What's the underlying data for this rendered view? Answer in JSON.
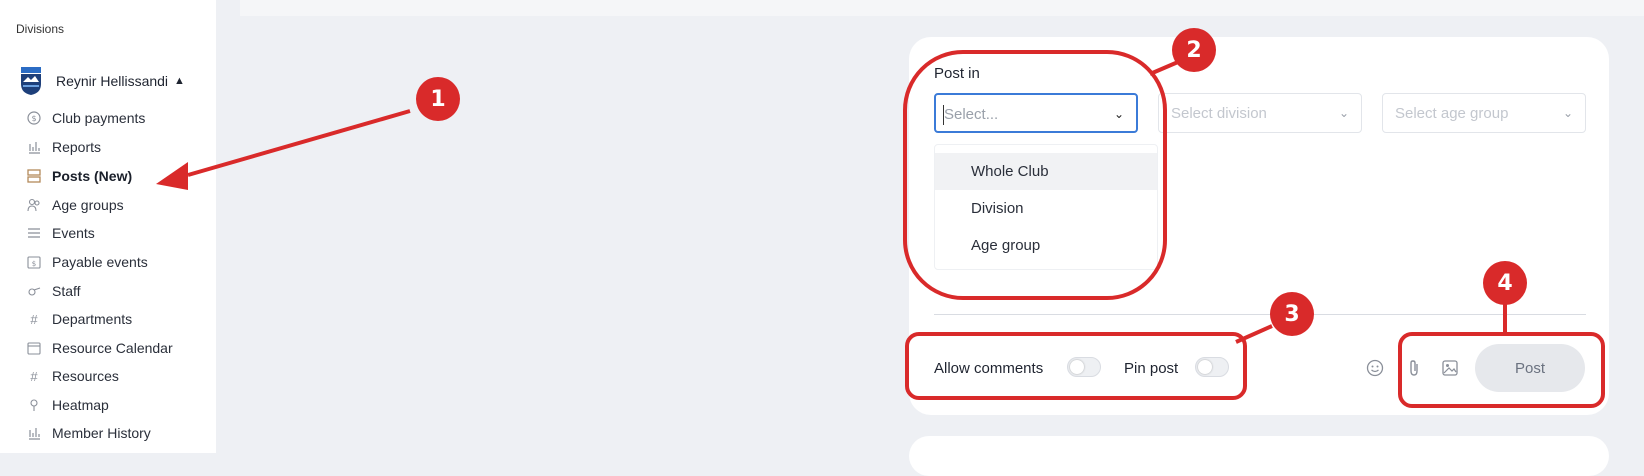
{
  "sidebar": {
    "title": "Divisions",
    "club_name": "Reynir Hellissandi",
    "items": [
      {
        "label": "Club payments",
        "icon": "dollar-circle-icon"
      },
      {
        "label": "Reports",
        "icon": "bar-chart-icon"
      },
      {
        "label": "Posts (New)",
        "icon": "posts-icon"
      },
      {
        "label": "Age groups",
        "icon": "users-icon"
      },
      {
        "label": "Events",
        "icon": "list-icon"
      },
      {
        "label": "Payable events",
        "icon": "calendar-dollar-icon"
      },
      {
        "label": "Staff",
        "icon": "whistle-icon"
      },
      {
        "label": "Departments",
        "icon": "hash-icon"
      },
      {
        "label": "Resource Calendar",
        "icon": "calendar-icon"
      },
      {
        "label": "Resources",
        "icon": "hash-icon"
      },
      {
        "label": "Heatmap",
        "icon": "pin-icon"
      },
      {
        "label": "Member History",
        "icon": "bar-chart-icon"
      }
    ]
  },
  "composer": {
    "post_in_label": "Post in",
    "select_placeholder": "Select...",
    "division_placeholder": "Select division",
    "age_group_placeholder": "Select age group",
    "options": [
      "Whole Club",
      "Division",
      "Age group"
    ],
    "allow_comments_label": "Allow comments",
    "pin_post_label": "Pin post",
    "post_button": "Post"
  },
  "annotations": {
    "badges": [
      "1",
      "2",
      "3",
      "4"
    ],
    "color": "#d92a2a"
  }
}
